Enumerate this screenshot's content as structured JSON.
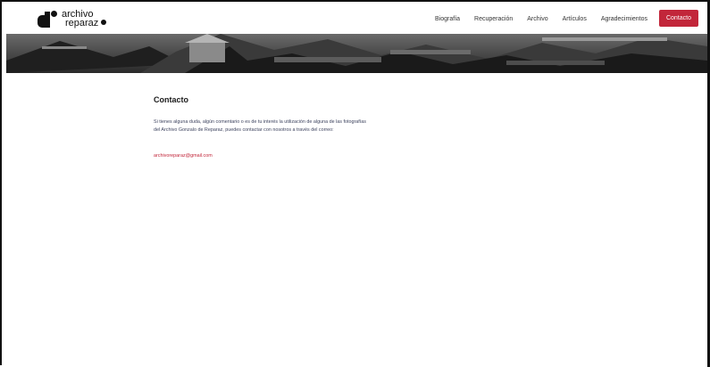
{
  "brand": {
    "line1": "archivo",
    "line2": "reparaz"
  },
  "nav": {
    "items": [
      "Biografía",
      "Recuperación",
      "Archivo",
      "Artículos",
      "Agradecimientos"
    ],
    "cta": "Contacto"
  },
  "page": {
    "title": "Contacto",
    "body": "Si tienes alguna duda, algún comentario o es de tu interés la utilización de alguna de las fotografías del Archivo Gonzalo de Reparaz, puedes contactar con nosotros a través del correo:",
    "email": "archivoreparaz@gmail.com"
  },
  "colors": {
    "accent": "#c2263a",
    "text": "#3f4560"
  }
}
